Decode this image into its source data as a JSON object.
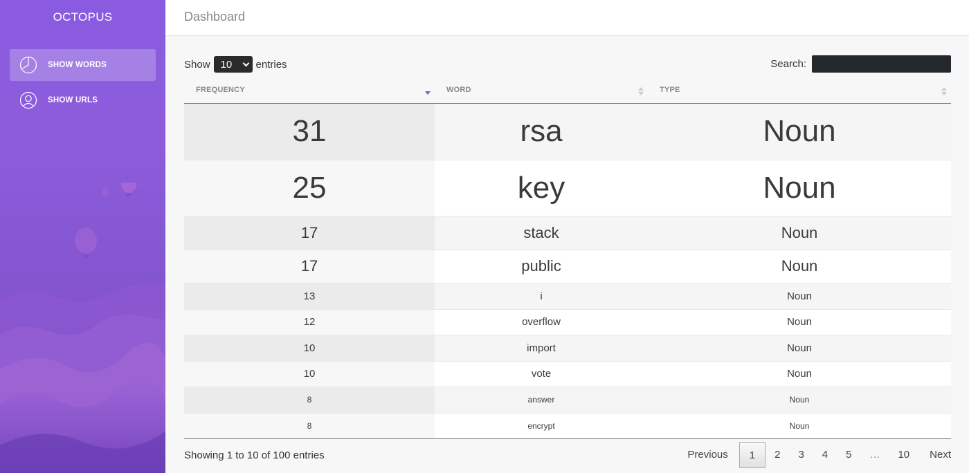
{
  "brand": "OCTOPUS",
  "sidebar": {
    "items": [
      {
        "label": "SHOW WORDS",
        "icon": "pie-chart-icon",
        "active": true
      },
      {
        "label": "SHOW URLS",
        "icon": "user-icon",
        "active": false
      }
    ]
  },
  "header": {
    "title": "Dashboard"
  },
  "controls": {
    "show_label": "Show",
    "entries_label": "entries",
    "page_length": "10",
    "search_label": "Search:",
    "search_value": ""
  },
  "table": {
    "columns": [
      {
        "label": "FREQUENCY",
        "sort": "desc"
      },
      {
        "label": "WORD",
        "sort": "none"
      },
      {
        "label": "TYPE",
        "sort": "none"
      }
    ],
    "rows": [
      {
        "frequency": "31",
        "word": "rsa",
        "type": "Noun"
      },
      {
        "frequency": "25",
        "word": "key",
        "type": "Noun"
      },
      {
        "frequency": "17",
        "word": "stack",
        "type": "Noun"
      },
      {
        "frequency": "17",
        "word": "public",
        "type": "Noun"
      },
      {
        "frequency": "13",
        "word": "i",
        "type": "Noun"
      },
      {
        "frequency": "12",
        "word": "overflow",
        "type": "Noun"
      },
      {
        "frequency": "10",
        "word": "import",
        "type": "Noun"
      },
      {
        "frequency": "10",
        "word": "vote",
        "type": "Noun"
      },
      {
        "frequency": "8",
        "word": "answer",
        "type": "Noun"
      },
      {
        "frequency": "8",
        "word": "encrypt",
        "type": "Noun"
      }
    ]
  },
  "footer": {
    "info": "Showing 1 to 10 of 100 entries",
    "pagination": {
      "previous": "Previous",
      "pages": [
        "1",
        "2",
        "3",
        "4",
        "5"
      ],
      "ellipsis": "…",
      "last": "10",
      "next": "Next",
      "current": "1"
    }
  },
  "colors": {
    "sidebar_accent": "#8a5be0",
    "sort_active": "#5b6cd6"
  }
}
